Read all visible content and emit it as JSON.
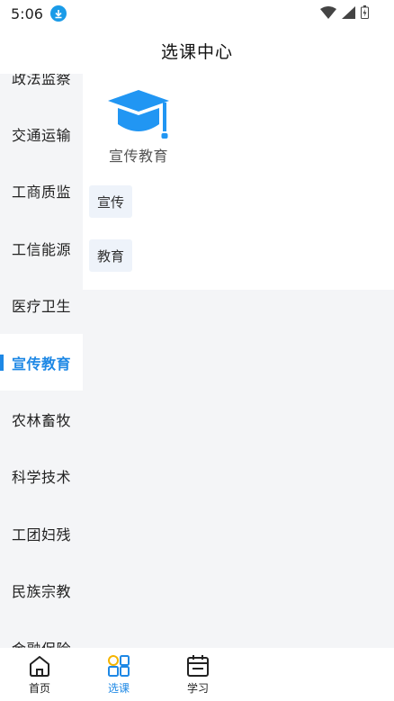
{
  "status_bar": {
    "time": "5:06"
  },
  "header": {
    "title": "选课中心"
  },
  "sidebar": {
    "items": [
      {
        "label": "政法监察"
      },
      {
        "label": "交通运输"
      },
      {
        "label": "工商质监"
      },
      {
        "label": "工信能源"
      },
      {
        "label": "医疗卫生"
      },
      {
        "label": "宣传教育",
        "active": true
      },
      {
        "label": "农林畜牧"
      },
      {
        "label": "科学技术"
      },
      {
        "label": "工团妇残"
      },
      {
        "label": "民族宗教"
      },
      {
        "label": "金融保险"
      }
    ]
  },
  "content": {
    "category_title": "宣传教育",
    "tags": [
      "宣传",
      "教育"
    ]
  },
  "bottom_nav": {
    "items": [
      {
        "label": "首页",
        "icon": "home-icon"
      },
      {
        "label": "选课",
        "icon": "grid-icon",
        "active": true
      },
      {
        "label": "学习",
        "icon": "calendar-icon"
      }
    ]
  },
  "colors": {
    "accent": "#1e88e5",
    "sidebar_bg": "#f4f5f7",
    "tag_bg": "#eef3fa"
  }
}
